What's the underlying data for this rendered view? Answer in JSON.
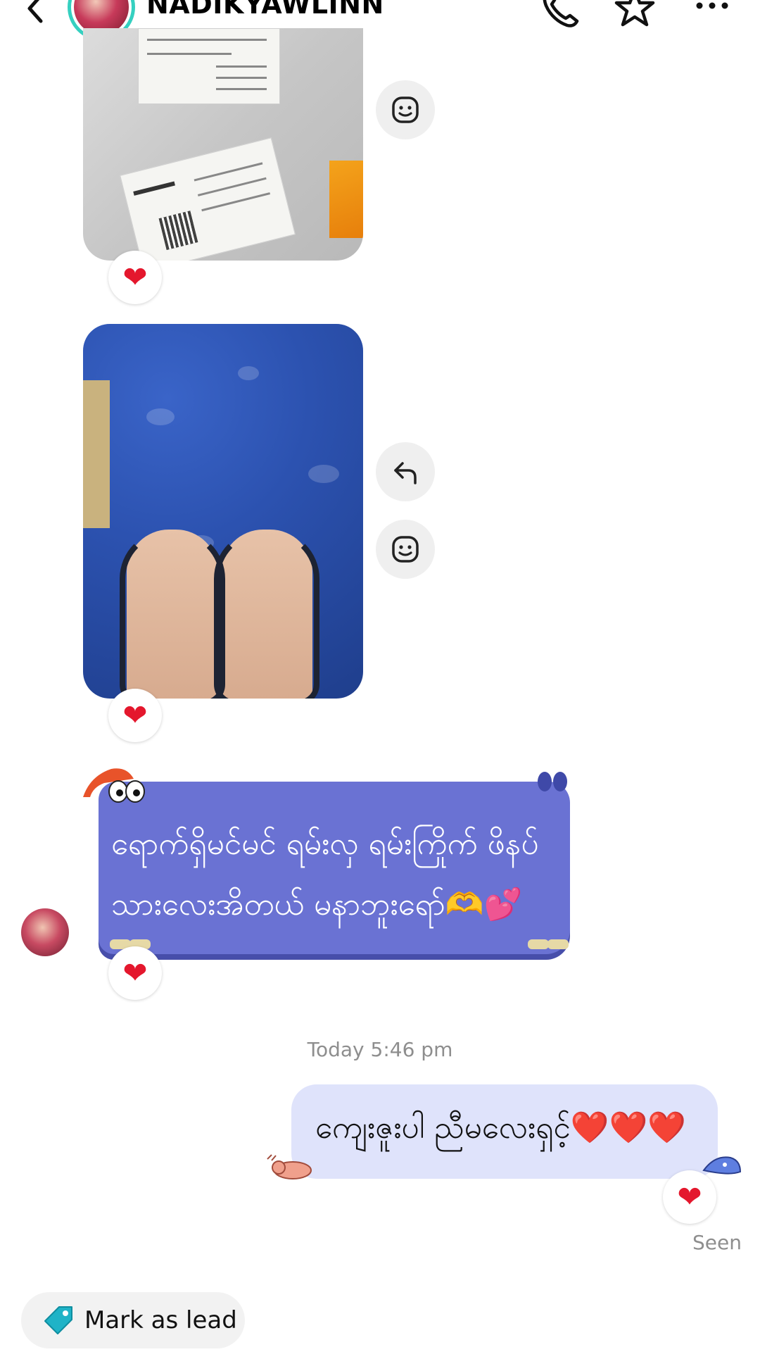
{
  "header": {
    "username": "NADIKYAWLINN",
    "icons": [
      "back-arrow-icon",
      "phone-icon",
      "star-icon",
      "more-icon"
    ]
  },
  "messages": {
    "incoming_text": "ရောက်ရှိမင်မင် ရမ်းလှ ရမ်းကြိုက် ဖိနပ်\nသားလေးအိတယ် မနာဘူးရော်🫶💕",
    "timestamp": "Today 5:46 pm",
    "outgoing_text": "ကျေးဇူးပါ ညီမလေးရှင့်",
    "outgoing_hearts": "❤️❤️❤️",
    "reaction": "❤",
    "status": "Seen"
  },
  "actions": {
    "mark_as_lead": "Mark as lead"
  },
  "colors": {
    "incoming_bubble": "#6a72d3",
    "outgoing_bubble": "#dfe3fb",
    "reaction_heart": "#e4172d",
    "story_ring": "#35d0c0",
    "tag_icon": "#1fb3c7"
  }
}
